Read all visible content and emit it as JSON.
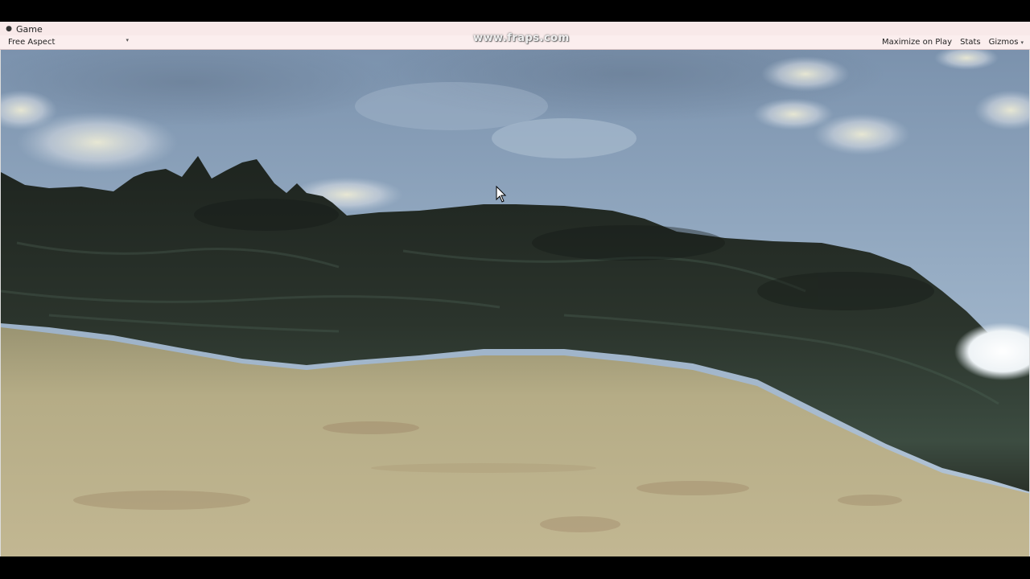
{
  "window": {
    "tab_icon": "unity-game-icon",
    "tab_title": "Game"
  },
  "toolbar": {
    "aspect_label": "Free Aspect",
    "maximize_label": "Maximize on Play",
    "stats_label": "Stats",
    "gizmos_label": "Gizmos"
  },
  "watermark": {
    "text": "www.fraps.com"
  },
  "viewport": {
    "scene": "terrain",
    "cursor_icon": "mouse-pointer-icon"
  }
}
